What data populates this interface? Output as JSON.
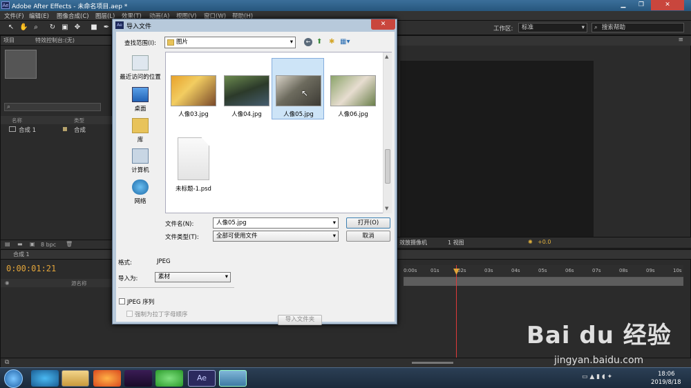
{
  "window": {
    "title": "Adobe After Effects - 未命名项目.aep *",
    "app_icon": "Ae"
  },
  "menu": [
    "文件(F)",
    "编辑(E)",
    "图像合成(C)",
    "图层(L)",
    "效果(T)",
    "动画(A)",
    "视图(V)",
    "窗口(W)",
    "帮助(H)"
  ],
  "toolbar": {
    "workspace_label": "工作区:",
    "workspace_value": "标准",
    "search_help": "搜索帮助"
  },
  "project_panel": {
    "tab": "项目",
    "effects_tab": "特效控制台:(无)",
    "col_name": "名称",
    "col_type": "类型",
    "items": [
      {
        "name": "合成 1",
        "type": "合成"
      }
    ],
    "bpc": "8 bpc"
  },
  "timeline": {
    "tab": "合成 1",
    "timecode": "0:00:01:21",
    "layer_col": "源名称",
    "ticks": [
      "0:00s",
      "01s",
      "02s",
      "03s",
      "04s",
      "05s",
      "06s",
      "07s",
      "08s",
      "09s",
      "10s"
    ]
  },
  "viewer": {
    "camera": "效放摄像机",
    "view": "1 视图",
    "exposure": "+0.0"
  },
  "dialog": {
    "title": "导入文件",
    "lookin_label": "查找范围(I):",
    "lookin_value": "图片",
    "places": [
      "最近访问的位置",
      "桌面",
      "库",
      "计算机",
      "网络"
    ],
    "files": [
      "人像03.jpg",
      "人像04.jpg",
      "人像05.jpg",
      "人像06.jpg",
      "未标题-1.psd"
    ],
    "filename_label": "文件名(N):",
    "filename_value": "人像05.jpg",
    "filetype_label": "文件类型(T):",
    "filetype_value": "全部可使用文件",
    "open_button": "打开(O)",
    "cancel_button": "取消",
    "format_label": "格式:",
    "format_value": "JPEG",
    "import_as_label": "导入为:",
    "import_as_value": "素材",
    "sequence_label": "JPEG 序列",
    "alpha_label": "强制为拉丁字母顺序",
    "import_folder_button": "导入文件夹"
  },
  "taskbar": {
    "time": "18:06",
    "date": "2019/8/18"
  },
  "watermark": {
    "brand": "Bai du 经验",
    "url": "jingyan.baidu.com"
  }
}
